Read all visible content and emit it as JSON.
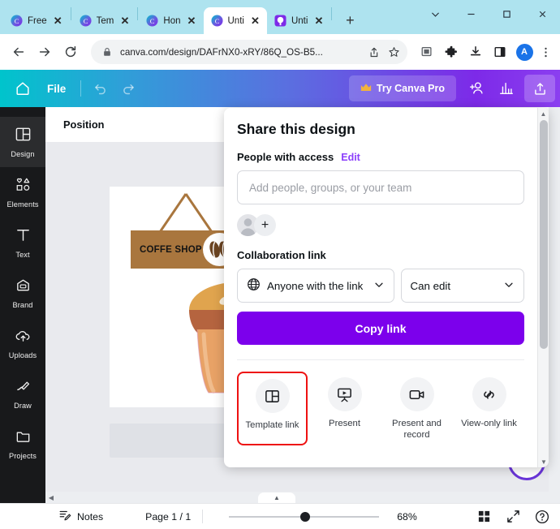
{
  "browser": {
    "tabs": [
      {
        "title": "Free",
        "favicon": "canva-icon",
        "active": false
      },
      {
        "title": "Tem",
        "favicon": "canva-icon",
        "active": false
      },
      {
        "title": "Hon",
        "favicon": "canva-icon",
        "active": false
      },
      {
        "title": "Unti",
        "favicon": "canva-icon",
        "active": true
      },
      {
        "title": "Unti",
        "favicon": "canva-purple-icon",
        "active": false
      }
    ],
    "new_tab_label": "+",
    "window_controls": [
      "tab-search-chevron",
      "minimize",
      "maximize",
      "close"
    ],
    "nav": {
      "back": "back-arrow",
      "forward": "forward-arrow",
      "reload": "reload-icon"
    },
    "omnibox": {
      "url": "canva.com/design/DAFrNX0-xRY/86Q_OS-B5...",
      "lock": "lock-icon",
      "share": "share-icon",
      "bookmark": "star-icon"
    },
    "extensions": [
      "capture-icon",
      "puzzle-icon",
      "download-icon",
      "side-panel-icon"
    ],
    "profile_initial": "A",
    "menu": "kebab-menu-icon"
  },
  "canva_header": {
    "home": "home-icon",
    "file_label": "File",
    "undo": "undo-icon",
    "redo": "redo-icon",
    "pro_label": "Try Canva Pro",
    "pro_crown": "crown-icon",
    "add_person": "add-person-icon",
    "insights": "insights-chart-icon",
    "share": "share-upload-icon"
  },
  "sidebar": {
    "items": [
      {
        "label": "Design",
        "icon": "design-layout-icon",
        "active": true
      },
      {
        "label": "Elements",
        "icon": "elements-shapes-icon",
        "active": false
      },
      {
        "label": "Text",
        "icon": "text-t-icon",
        "active": false
      },
      {
        "label": "Brand",
        "icon": "brand-kit-icon",
        "active": false
      },
      {
        "label": "Uploads",
        "icon": "upload-cloud-icon",
        "active": false
      },
      {
        "label": "Draw",
        "icon": "draw-pen-icon",
        "active": false
      },
      {
        "label": "Projects",
        "icon": "folder-icon",
        "active": false
      }
    ]
  },
  "editor": {
    "position_tab": "Position",
    "artwork": {
      "sign_text": "COFFE SHOP",
      "sign_color": "#a9763e",
      "bean_color": "#6b4422",
      "cup_color": "#e0a44e"
    }
  },
  "share_dialog": {
    "title": "Share this design",
    "people_label": "People with access",
    "edit_link": "Edit",
    "input_placeholder": "Add people, groups, or your team",
    "avatar": "person-avatar",
    "add_person": "+",
    "collaboration_label": "Collaboration link",
    "access_select": {
      "value": "Anyone with the link",
      "icon": "globe-icon",
      "chevron": "chevron-down-icon"
    },
    "permission_select": {
      "value": "Can edit",
      "chevron": "chevron-down-icon"
    },
    "copy_button": "Copy link",
    "copy_button_color": "#7c00ec",
    "highlight_color": "#ee1111",
    "actions": [
      {
        "label": "Template link",
        "icon": "template-link-icon",
        "highlighted": true
      },
      {
        "label": "Present",
        "icon": "present-screen-icon",
        "highlighted": false
      },
      {
        "label": "Present and record",
        "icon": "video-camera-icon",
        "highlighted": false
      },
      {
        "label": "View-only link",
        "icon": "chain-link-icon",
        "highlighted": false
      }
    ]
  },
  "bottom_bar": {
    "notes_label": "Notes",
    "notes_icon": "notes-icon",
    "page_label": "Page 1 / 1",
    "zoom_level": "68%",
    "grid_icon": "grid-view-icon",
    "expand_icon": "fullscreen-icon",
    "help_icon": "help-icon"
  }
}
